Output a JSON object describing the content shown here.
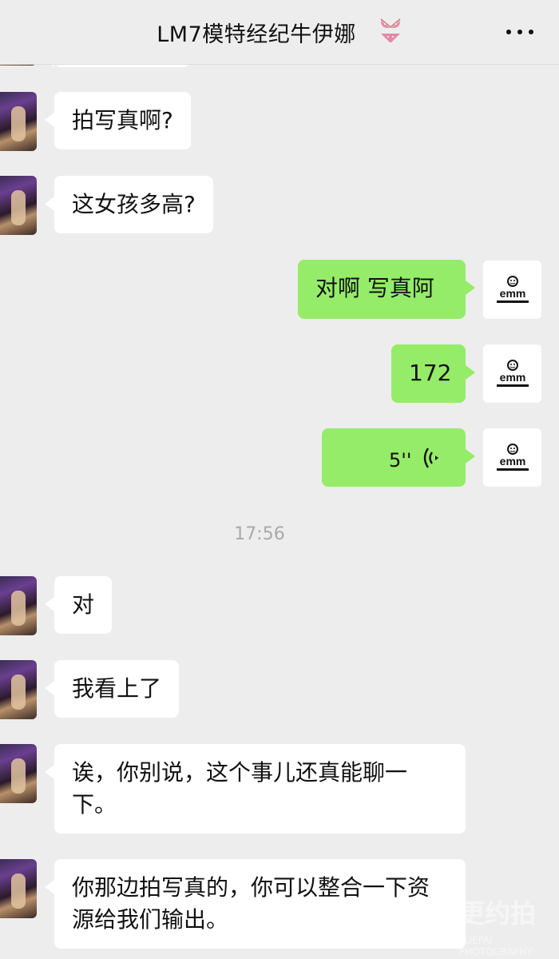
{
  "header": {
    "title": "LM7模特经纪牛伊娜",
    "more_icon": "more-icon",
    "title_icon": "bikini-icon"
  },
  "messages": [
    {
      "side": "in",
      "text": "拍写真啊?"
    },
    {
      "side": "in",
      "text": "这女孩多高?"
    },
    {
      "side": "out",
      "text": "对啊 写真阿"
    },
    {
      "side": "out",
      "text": "172"
    },
    {
      "side": "out",
      "type": "voice",
      "duration": "5''"
    },
    {
      "side": "in",
      "text": "对"
    },
    {
      "side": "in",
      "text": "我看上了"
    },
    {
      "side": "in",
      "text": "诶，你别说，这个事儿还真能聊一下。"
    },
    {
      "side": "in",
      "text": "你那边拍写真的，你可以整合一下资源给我们输出。"
    }
  ],
  "timestamp": "17:56",
  "avatar_label": "emm",
  "watermark": {
    "text": "更约拍",
    "sub": "YUEPAI PHOTOGRAPHY"
  },
  "colors": {
    "outgoing": "#95ec69",
    "incoming": "#ffffff",
    "background": "#ededed"
  }
}
